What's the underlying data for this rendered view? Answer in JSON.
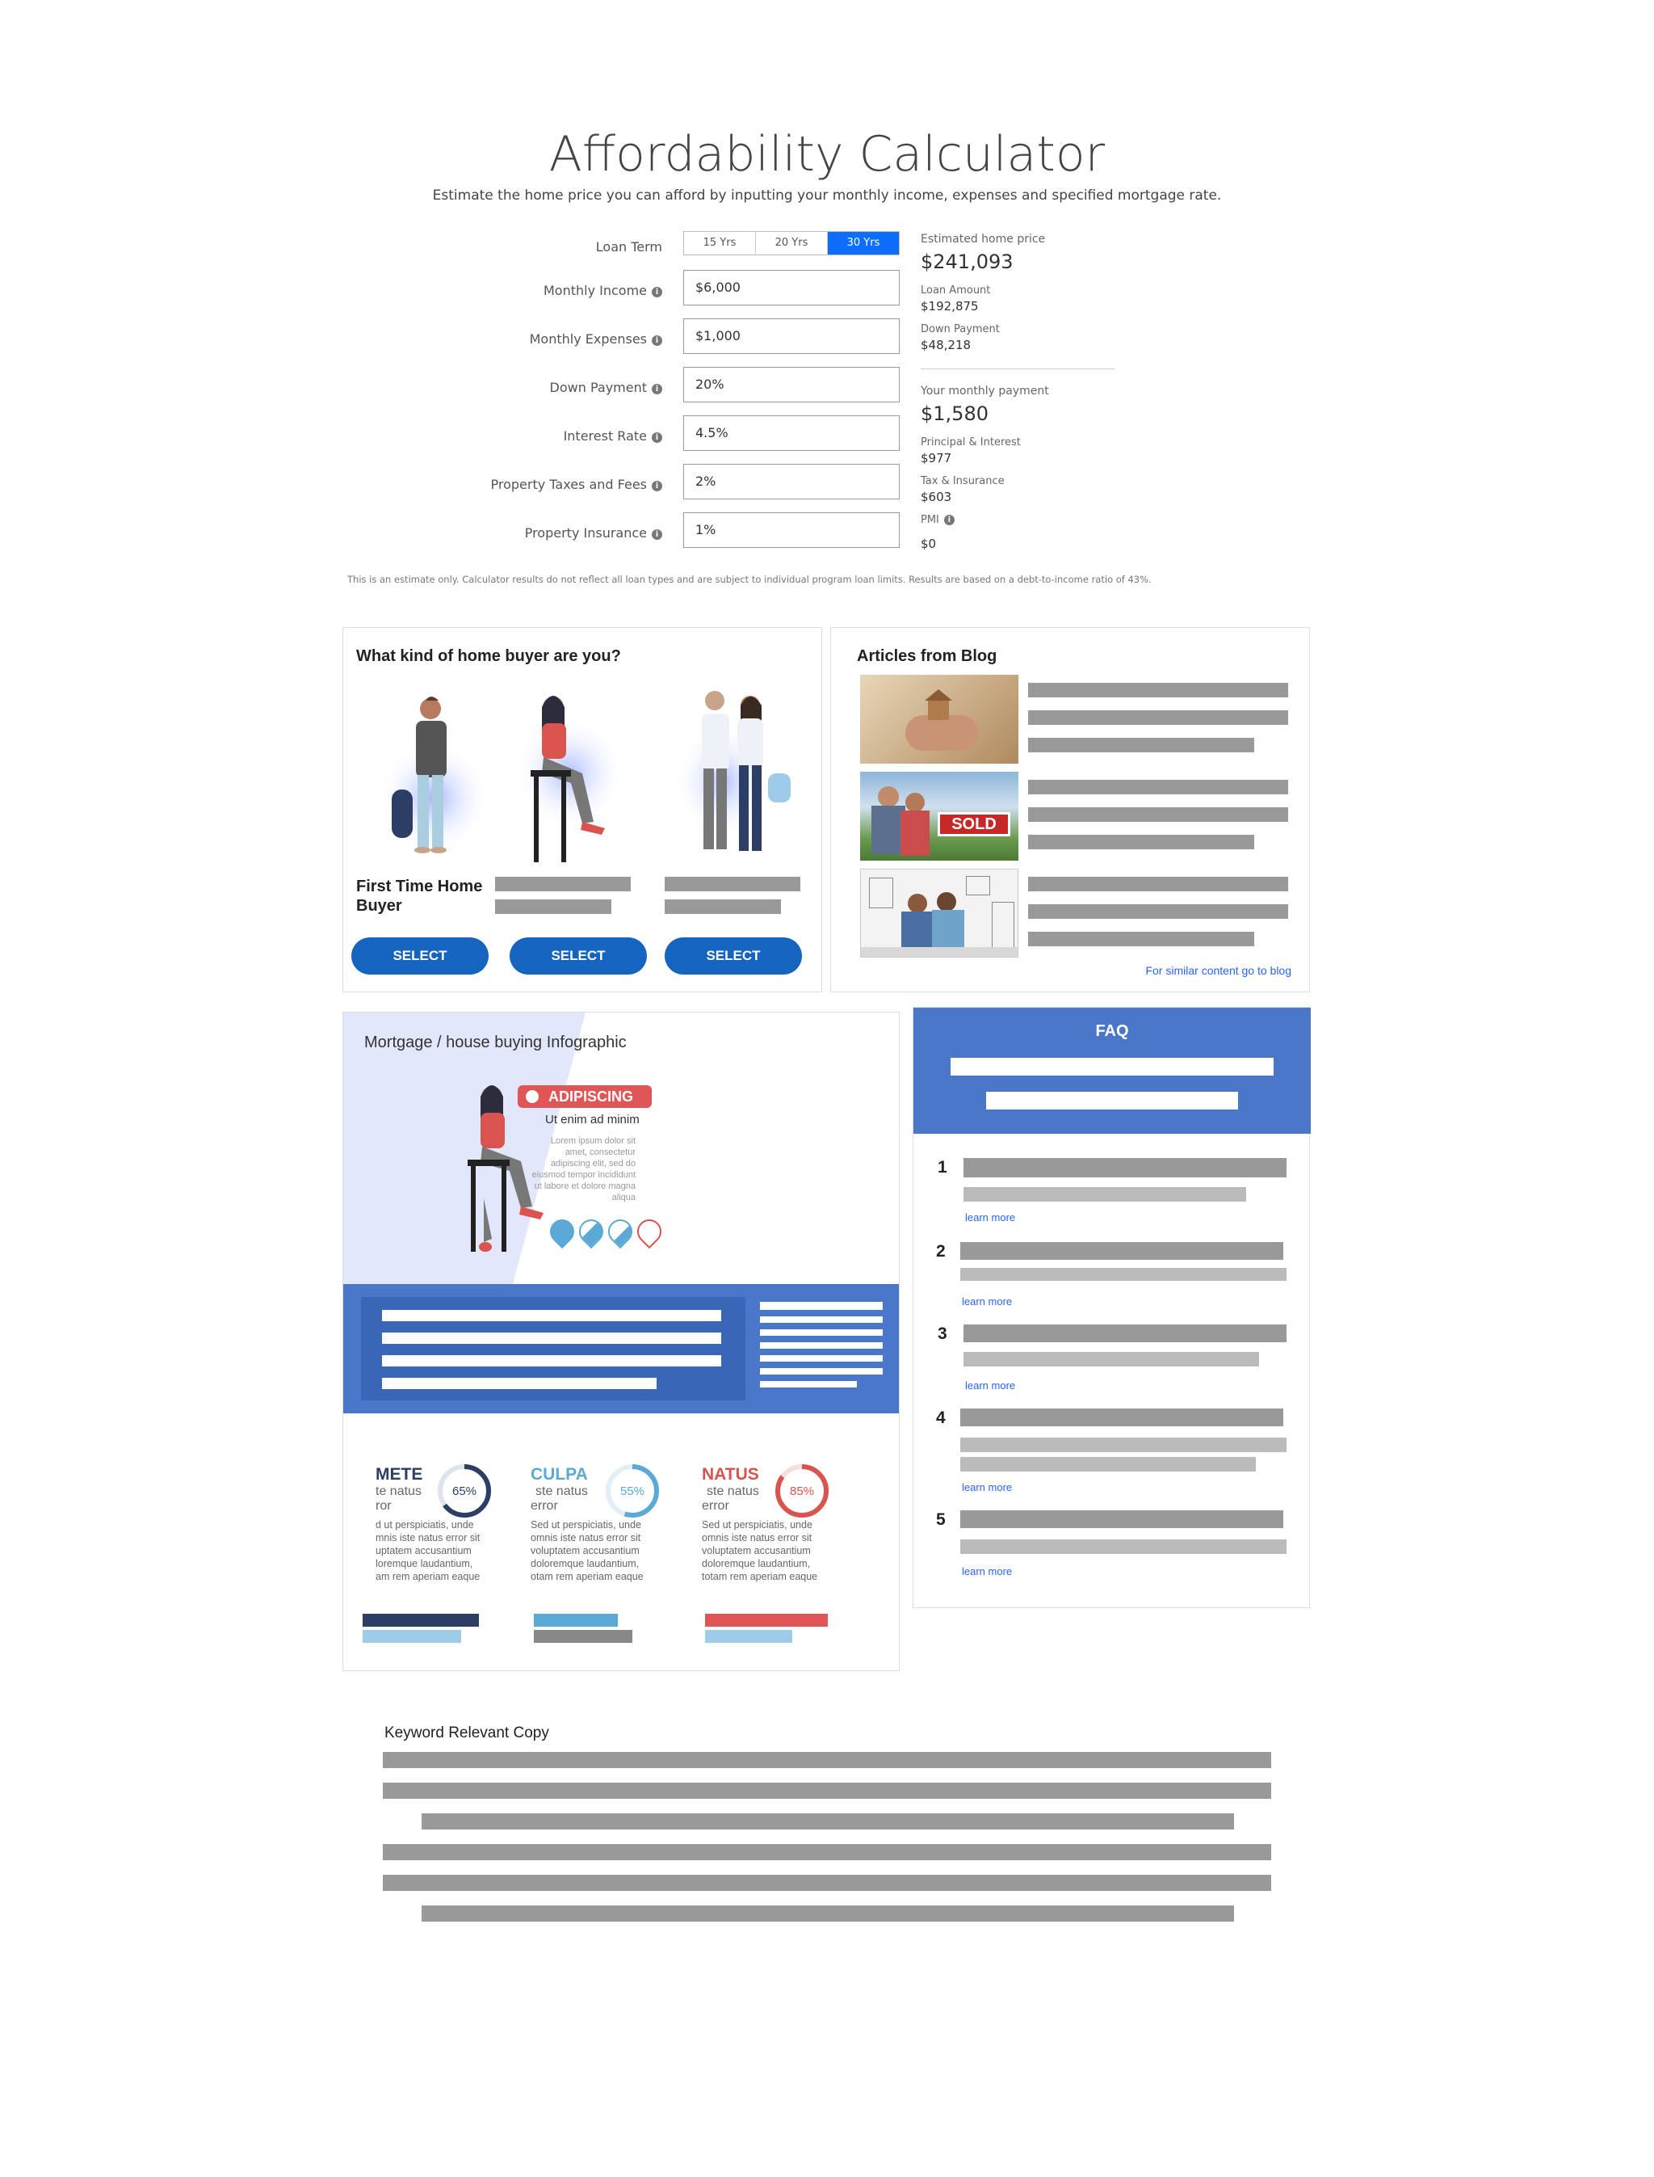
{
  "header": {
    "title": "Affordability Calculator",
    "subtitle": "Estimate the home price you can afford by inputting your monthly income, expenses and specified mortgage rate."
  },
  "calculator": {
    "loan_term_label": "Loan Term",
    "loan_term_options": [
      "15 Yrs",
      "20 Yrs",
      "30 Yrs"
    ],
    "loan_term_selected": "30 Yrs",
    "fields": [
      {
        "label": "Monthly Income",
        "value": "$6,000"
      },
      {
        "label": "Monthly Expenses",
        "value": "$1,000"
      },
      {
        "label": "Down Payment",
        "value": "20%"
      },
      {
        "label": "Interest Rate",
        "value": "4.5%"
      },
      {
        "label": "Property Taxes and Fees",
        "value": "2%"
      },
      {
        "label": "Property Insurance",
        "value": "1%"
      }
    ],
    "info_glyph": "i",
    "disclaimer": "This is an estimate only. Calculator results do not reflect all loan types and are subject to individual program loan limits. Results are based on a debt-to-income ratio of 43%."
  },
  "results": {
    "est_price_label": "Estimated home price",
    "est_price_value": "$241,093",
    "loan_amount_label": "Loan Amount",
    "loan_amount_value": "$192,875",
    "down_payment_label": "Down Payment",
    "down_payment_value": "$48,218",
    "monthly_label": "Your monthly payment",
    "monthly_value": "$1,580",
    "pi_label": "Principal & Interest",
    "pi_value": "$977",
    "ti_label": "Tax & Insurance",
    "ti_value": "$603",
    "pmi_label": "PMI",
    "pmi_value": "$0"
  },
  "buyer": {
    "title": "What kind of home buyer are you?",
    "first_label": "First Time Home Buyer",
    "select_label": "SELECT"
  },
  "blog": {
    "title": "Articles from Blog",
    "sold_sign": "SOLD",
    "link": "For similar content go to blog"
  },
  "infographic": {
    "title": "Mortgage / house buying Infographic",
    "badge": "ADIPISCING",
    "tagline": "Ut enim ad minim",
    "lorem_lines": [
      "Lorem ipsum dolor sit",
      "amet, consectetur",
      "adipiscing elit, sed do",
      "eiusmod tempor incididunt",
      "ut labore et dolore magna",
      "aliqua"
    ],
    "stats": [
      {
        "title": "METE",
        "sub1": "te natus",
        "sub2": "ror",
        "pct": "65%",
        "value": 65,
        "color": "#2c3e66",
        "body": [
          "d ut perspiciatis, unde",
          "mnis iste natus error sit",
          "uptatem accusantium",
          "loremque laudantium,",
          "am rem aperiam eaque"
        ]
      },
      {
        "title": "CULPA",
        "sub1": "ste natus",
        "sub2": "error",
        "pct": "55%",
        "value": 55,
        "color": "#5aa9d6",
        "body": [
          "Sed ut perspiciatis, unde",
          "omnis iste natus error sit",
          "voluptatem accusantium",
          "doloremque laudantium,",
          "otam rem aperiam eaque"
        ]
      },
      {
        "title": "NATUS",
        "sub1": "ste natus",
        "sub2": "error",
        "pct": "85%",
        "value": 85,
        "color": "#d9534f",
        "body": [
          "Sed ut perspiciatis, unde",
          "omnis iste natus error sit",
          "voluptatem accusantium",
          "doloremque laudantium,",
          "totam rem aperiam eaque"
        ]
      }
    ]
  },
  "faq": {
    "title": "FAQ",
    "numbers": [
      "1",
      "2",
      "3",
      "4",
      "5"
    ],
    "learn_more": "learn more"
  },
  "keyword": {
    "title": "Keyword Relevant Copy"
  },
  "colors": {
    "primary": "#0d6efd",
    "select_button": "#1565c0",
    "faq_header": "#4a77c9",
    "placeholder_bar": "#999999",
    "link": "#2962ff"
  }
}
